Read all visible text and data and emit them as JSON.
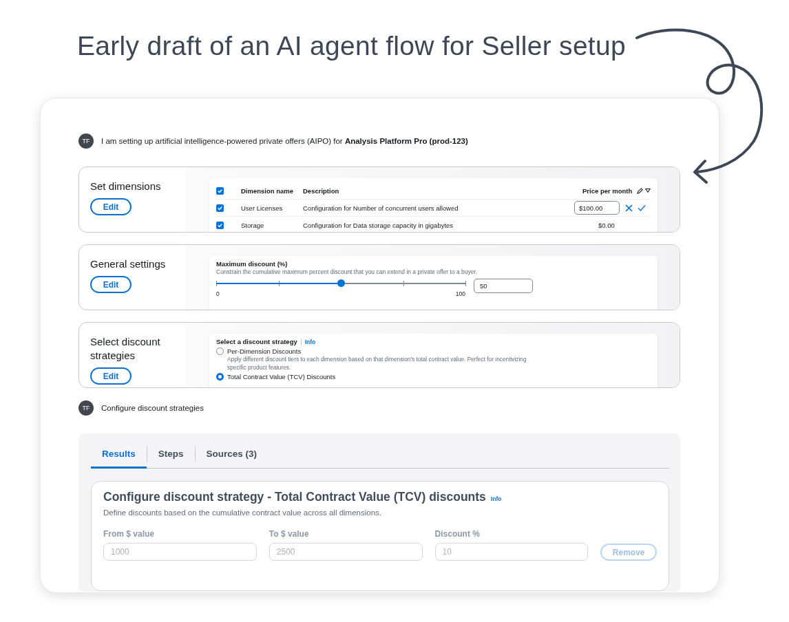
{
  "title": "Early draft of an AI agent flow for Seller setup",
  "messages": [
    {
      "avatar": "TF",
      "text": "I am setting up artificial intelligence-powered private offers (AIPO) for **Analysis Platform Pro (prod-123)**"
    }
  ],
  "sections": [
    {
      "kind": "table",
      "title": "Set dimensions",
      "edit_label": "Edit",
      "table": {
        "header_checked": true,
        "columns": [
          "Dimension name",
          "Description",
          "Price per month"
        ],
        "rows": [
          {
            "checked": true,
            "name": "User Licenses",
            "description": "Configuration for Number of concurrent users allowed",
            "price": "$100.00",
            "editing": true
          },
          {
            "checked": true,
            "name": "Storage",
            "description": "Configuration for Data storage capacity in gigabytes",
            "price": "$0.00",
            "editing": false
          }
        ]
      }
    },
    {
      "kind": "slider",
      "title": "General settings",
      "edit_label": "Edit",
      "label": "Maximum discount (%)",
      "description": "Constrain the cumulative maximum percent discount that you can extend in a private offer to a buyer.",
      "level": 0.5,
      "min": "0",
      "max": "100",
      "value": "50"
    },
    {
      "kind": "radio",
      "title": "Select discount strategies",
      "edit_label": "Edit",
      "label": "Select a discount strategy",
      "info": "Info",
      "options": [
        {
          "label": "Per-Dimension Discounts",
          "description": "Apply different discount tiers to each dimension based on that dimension's total contract value. Perfect for incentivizing specific product features.",
          "selected": false
        },
        {
          "label": "Total Contract Value (TCV) Discounts",
          "selected": true
        }
      ]
    }
  ],
  "reply": {
    "avatar": "TF",
    "text": "Configure discount strategies"
  },
  "results": {
    "tabs": [
      {
        "label": "Results",
        "selected": true
      },
      {
        "label": "Steps",
        "selected": false
      },
      {
        "label": "Sources (3)",
        "selected": false
      }
    ],
    "card": {
      "title": "Configure discount strategy - Total Contract Value (TCV) discounts",
      "info": "Info",
      "description": "Define discounts based on the cumulative contract value across all dimensions.",
      "fields": [
        {
          "label": "From $ value",
          "value": "1000"
        },
        {
          "label": "To $ value",
          "value": "2500"
        },
        {
          "label": "Discount %",
          "value": "10"
        }
      ],
      "remove": {
        "label": "Remove",
        "disabled": true
      }
    }
  }
}
